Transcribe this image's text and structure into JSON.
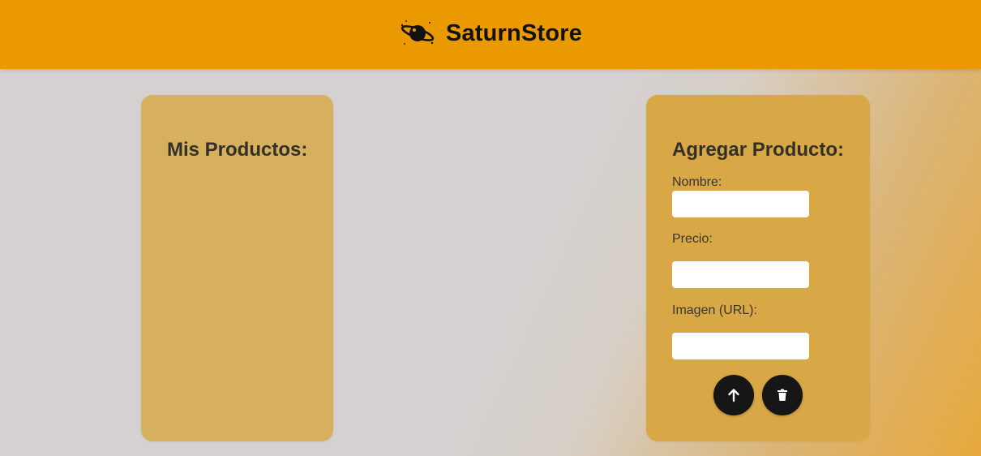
{
  "header": {
    "brand_name": "SaturnStore",
    "logo_icon": "saturn-planet-icon",
    "background_color": "#ea9a00"
  },
  "products_panel": {
    "title": "Mis Productos:",
    "items": []
  },
  "add_product_panel": {
    "title": "Agregar Producto:",
    "fields": {
      "name": {
        "label": "Nombre:",
        "value": ""
      },
      "price": {
        "label": "Precio:",
        "value": ""
      },
      "image_url": {
        "label": "Imagen (URL):",
        "value": ""
      }
    },
    "buttons": {
      "submit_icon": "arrow-up-icon",
      "clear_icon": "trash-icon"
    }
  },
  "colors": {
    "accent": "#ea9a00",
    "card": "#d9a846",
    "button": "#161616"
  }
}
